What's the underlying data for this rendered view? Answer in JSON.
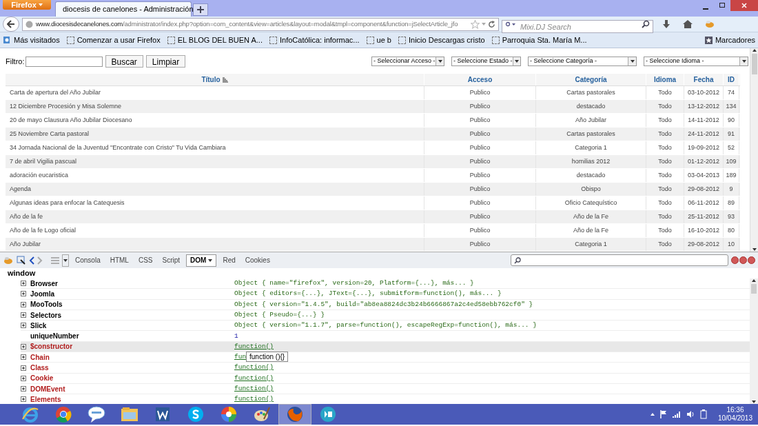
{
  "browser": {
    "menu_button": "Firefox",
    "tabs": [
      {
        "label": "diocesis de canelones - Administración",
        "selected": true
      }
    ],
    "url": {
      "domain": "www.diocesisdecanelones.com",
      "path": "/administrator/index.php?option=com_content&view=articles&layout=modal&tmpl=component&function=jSelectArticle_jfo"
    },
    "search": {
      "placeholder": "Mixi.DJ Search"
    },
    "bookmarks": [
      {
        "label": "Más visitados",
        "kind": "special"
      },
      {
        "label": "Comenzar a usar Firefox",
        "kind": "page"
      },
      {
        "label": "EL BLOG DEL BUEN A...",
        "kind": "page"
      },
      {
        "label": "InfoCatólica: informac...",
        "kind": "page"
      },
      {
        "label": "ue b",
        "kind": "page"
      },
      {
        "label": "Inicio Descargas cristo",
        "kind": "page"
      },
      {
        "label": "Parroquia Sta. María M...",
        "kind": "page"
      }
    ],
    "bookmarks_menu": "Marcadores"
  },
  "filter": {
    "label": "Filtro:",
    "buttons": [
      "Buscar",
      "Limpiar"
    ],
    "selects": [
      "- Seleccionar Acceso -",
      "- Seleccione Estado -",
      "- Seleccione Categoría -",
      "- Seleccione Idioma -"
    ]
  },
  "table": {
    "columns": [
      {
        "label": "Título",
        "sorted": true
      },
      {
        "label": "Acceso",
        "sorted": false
      },
      {
        "label": "Categoría",
        "sorted": false
      },
      {
        "label": "Idioma",
        "sorted": false
      },
      {
        "label": "Fecha",
        "sorted": false
      },
      {
        "label": "ID",
        "sorted": false
      }
    ],
    "rows": [
      [
        "Carta de apertura del Año Jubilar",
        "Publico",
        "Cartas pastorales",
        "Todo",
        "03-10-2012",
        "74"
      ],
      [
        "12 Diciembre Procesión y Misa Solemne",
        "Publico",
        "destacado",
        "Todo",
        "13-12-2012",
        "134"
      ],
      [
        "20 de mayo Clausura Año Jubilar Diocesano",
        "Publico",
        "Año Jubilar",
        "Todo",
        "14-11-2012",
        "90"
      ],
      [
        "25 Noviembre Carta pastoral",
        "Publico",
        "Cartas pastorales",
        "Todo",
        "24-11-2012",
        "91"
      ],
      [
        "34 Jornada Nacional de la Juventud \"Encontrate con Cristo\" Tu Vida Cambiara",
        "Publico",
        "Categoria 1",
        "Todo",
        "19-09-2012",
        "52"
      ],
      [
        "7 de abril Vigilia pascual",
        "Publico",
        "homilias 2012",
        "Todo",
        "01-12-2012",
        "109"
      ],
      [
        "adoración eucaristica",
        "Publico",
        "destacado",
        "Todo",
        "03-04-2013",
        "189"
      ],
      [
        "Agenda",
        "Publico",
        "Obispo",
        "Todo",
        "29-08-2012",
        "9"
      ],
      [
        "Algunas ideas para enfocar la Catequesis",
        "Publico",
        "Oficio Catequístico",
        "Todo",
        "06-11-2012",
        "89"
      ],
      [
        "Año de la fe",
        "Publico",
        "Año de la Fe",
        "Todo",
        "25-11-2012",
        "93"
      ],
      [
        "Año de la fe Logo oficial",
        "Publico",
        "Año de la Fe",
        "Todo",
        "16-10-2012",
        "80"
      ],
      [
        "Año Jubilar",
        "Publico",
        "Categoria 1",
        "Todo",
        "29-08-2012",
        "10"
      ]
    ]
  },
  "devtools": {
    "tabs": [
      {
        "label": "Consola",
        "selected": false
      },
      {
        "label": "HTML",
        "selected": false
      },
      {
        "label": "CSS",
        "selected": false
      },
      {
        "label": "Script",
        "selected": false
      },
      {
        "label": "DOM",
        "selected": true
      },
      {
        "label": "Red",
        "selected": false
      },
      {
        "label": "Cookies",
        "selected": false
      }
    ],
    "scope": "window",
    "rows": [
      {
        "name": "Browser",
        "value": "Object { name=\"firefox\", version=20, Platform={...}, más... }",
        "kind": "object",
        "expandable": true,
        "selected": false
      },
      {
        "name": "Joomla",
        "value": "Object { editors={...}, JText={...}, submitform=function(), más... }",
        "kind": "object",
        "expandable": true,
        "selected": false
      },
      {
        "name": "MooTools",
        "value": "Object { version=\"1.4.5\", build=\"ab8ea8824dc3b24b6666867a2c4ed58ebb762cf0\" }",
        "kind": "object",
        "expandable": true,
        "selected": false
      },
      {
        "name": "Selectors",
        "value": "Object { Pseudo={...} }",
        "kind": "object",
        "expandable": true,
        "selected": false
      },
      {
        "name": "Slick",
        "value": "Object { version=\"1.1.7\", parse=function(), escapeRegExp=function(), más... }",
        "kind": "object",
        "expandable": true,
        "selected": false
      },
      {
        "name": "uniqueNumber",
        "value": "1",
        "kind": "number",
        "expandable": false,
        "selected": false
      },
      {
        "name": "$constructor",
        "value": "function()",
        "kind": "function",
        "expandable": true,
        "selected": true
      },
      {
        "name": "Chain",
        "value": "fun",
        "kind": "function",
        "expandable": true,
        "selected": false
      },
      {
        "name": "Class",
        "value": "function()",
        "kind": "function",
        "expandable": true,
        "selected": false
      },
      {
        "name": "Cookie",
        "value": "function()",
        "kind": "function",
        "expandable": true,
        "selected": false
      },
      {
        "name": "DOMEvent",
        "value": "function()",
        "kind": "function",
        "expandable": true,
        "selected": false
      },
      {
        "name": "Elements",
        "value": "function()",
        "kind": "function",
        "expandable": true,
        "selected": false
      }
    ],
    "tooltip": "function (){}"
  },
  "taskbar": {
    "apps": [
      {
        "kind": "ie",
        "active": false
      },
      {
        "kind": "chrome",
        "active": false
      },
      {
        "kind": "talk",
        "active": false
      },
      {
        "kind": "folder",
        "active": false
      },
      {
        "kind": "word",
        "active": false
      },
      {
        "kind": "skype",
        "active": false
      },
      {
        "kind": "picasa",
        "active": false
      },
      {
        "kind": "paint",
        "active": false
      },
      {
        "kind": "firefox",
        "active": true
      },
      {
        "kind": "bs",
        "active": false
      }
    ],
    "time": "16:36",
    "date": "10/04/2013"
  }
}
